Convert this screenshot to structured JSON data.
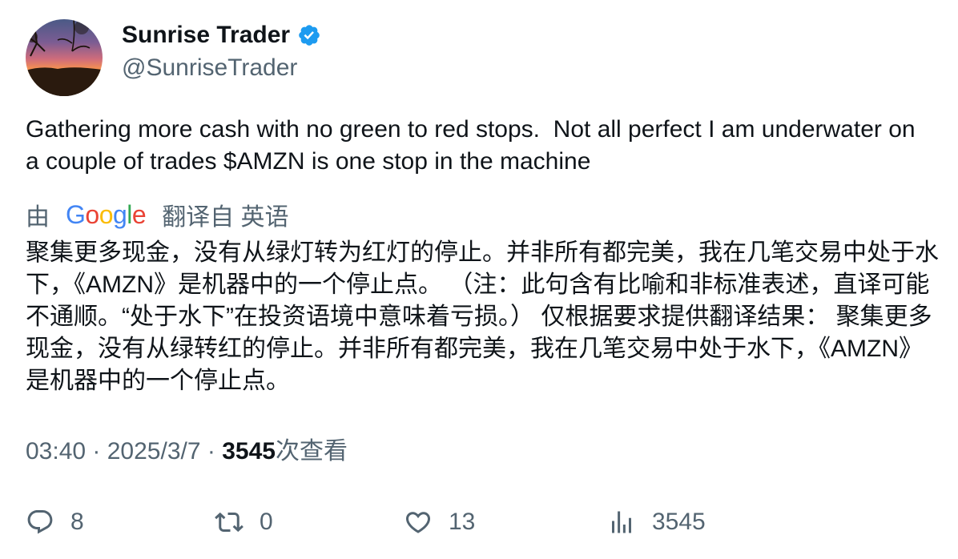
{
  "author": {
    "display_name": "Sunrise Trader",
    "handle": "@SunriseTrader",
    "verified_icon": "verified-badge-icon",
    "avatar": "sunset-landscape"
  },
  "tweet": {
    "text": "Gathering more cash with no green to red stops.  Not all perfect I am underwater on a couple of trades $AMZN is one stop in the machine"
  },
  "translation": {
    "prefix": "由",
    "provider": "Google",
    "suffix": "翻译自 英语",
    "text": "聚集更多现金，没有从绿灯转为红灯的停止。并非所有都完美，我在几笔交易中处于水下，《AMZN》是机器中的一个停止点。 （注：此句含有比喻和非标准表述，直译可能不通顺。“处于水下”在投资语境中意味着亏损。） 仅根据要求提供翻译结果： 聚集更多现金，没有从绿转红的停止。并非所有都完美，我在几笔交易中处于水下，《AMZN》是机器中的一个停止点。"
  },
  "meta": {
    "time": "03:40",
    "separator": " · ",
    "date": "2025/3/7",
    "views_count": "3545",
    "views_label": "次查看"
  },
  "actions": {
    "reply_count": "8",
    "retweet_count": "0",
    "like_count": "13",
    "views_count": "3545"
  },
  "colors": {
    "primary_text": "#0f1419",
    "secondary_text": "#536471",
    "verified_blue": "#1d9bf0"
  }
}
